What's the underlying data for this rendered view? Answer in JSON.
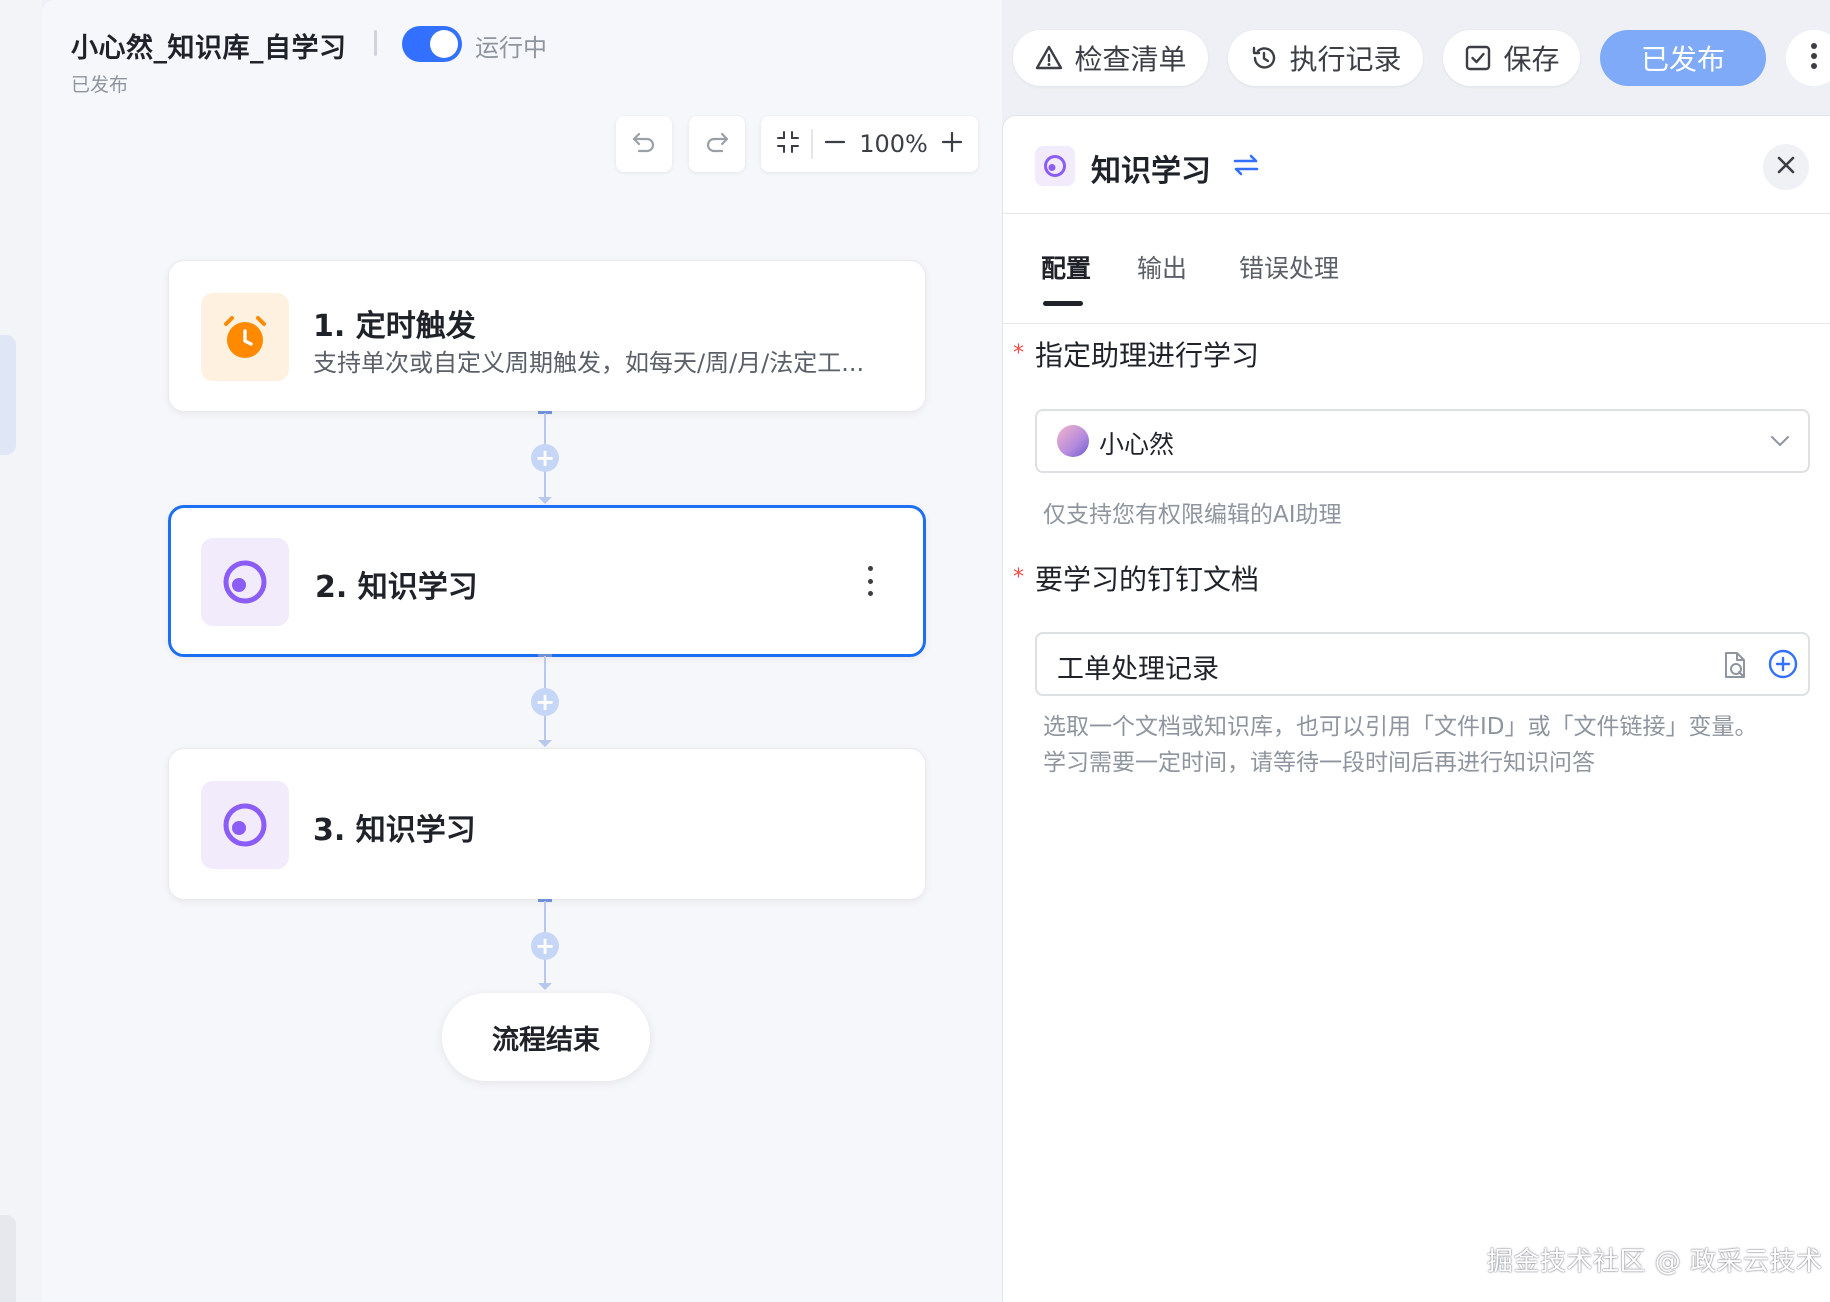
{
  "header": {
    "title": "小心然_知识库_自学习",
    "subtitle": "已发布",
    "toggle_label": "运行中",
    "toggle_on": true,
    "buttons": {
      "check": "检查清单",
      "log": "执行记录",
      "save": "保存",
      "published": "已发布"
    }
  },
  "toolbar": {
    "zoom": "100%"
  },
  "flow": {
    "nodes": [
      {
        "title": "1. 定时触发",
        "desc": "支持单次或自定义周期触发，如每天/周/月/法定工..."
      },
      {
        "title": "2. 知识学习",
        "desc": ""
      },
      {
        "title": "3. 知识学习",
        "desc": ""
      }
    ],
    "end_label": "流程结束"
  },
  "panel": {
    "title": "知识学习",
    "tabs": [
      "配置",
      "输出",
      "错误处理"
    ],
    "active_tab": "配置",
    "field1": {
      "label": "指定助理进行学习",
      "value": "小心然",
      "help": "仅支持您有权限编辑的AI助理"
    },
    "field2": {
      "label": "要学习的钉钉文档",
      "value": "工单处理记录",
      "help_line1": "选取一个文档或知识库，也可以引用「文件ID」或「文件链接」变量。",
      "help_line2": "学习需要一定时间，请等待一段时间后再进行知识问答"
    }
  },
  "watermark": "掘金技术社区 @ 政采云技术",
  "colors": {
    "accent": "#3370ff",
    "published_btn": "#7faaf7",
    "selected_border": "#1d6ff2",
    "required": "#f54a45",
    "trigger_icon": "#ff8a00",
    "knowledge_icon": "#8b5cf6"
  }
}
